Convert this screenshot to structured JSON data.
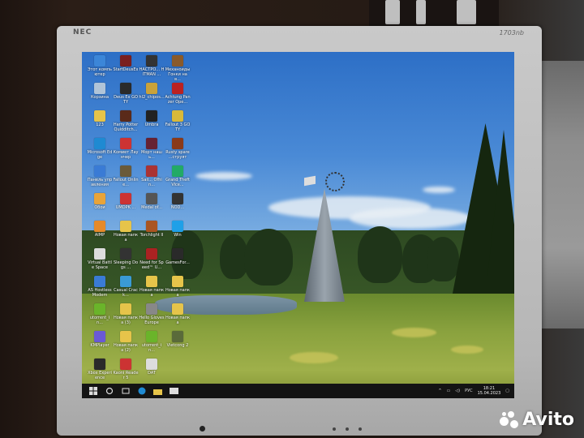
{
  "bezel": {
    "brand": "NEC",
    "model": "1703nb"
  },
  "taskbar": {
    "language": "РУС",
    "time": "18:21",
    "date": "15.04.2023"
  },
  "desktop_icons": [
    {
      "label": "Этот компьютер",
      "color": "#3c86d8"
    },
    {
      "label": "StartDeusEx",
      "color": "#7a1f1f"
    },
    {
      "label": "НАСТРО... HITMAN ...",
      "color": "#333"
    },
    {
      "label": "Механоиды Гонки на в...",
      "color": "#8a5a2a"
    },
    {
      "label": "Корзина",
      "color": "#b0c4d8"
    },
    {
      "label": "Deus Ex GOTY",
      "color": "#2a2a2a"
    },
    {
      "label": "hl2_chipos...",
      "color": "#c9a23a"
    },
    {
      "label": "Achtung Panzer Ope...",
      "color": "#b22"
    },
    {
      "label": "123",
      "color": "#e6c44a"
    },
    {
      "label": "Harry Potter Quidditch...",
      "color": "#5a2a1a"
    },
    {
      "label": "Umbra",
      "color": "#222"
    },
    {
      "label": "Fallout 3 GOTY",
      "color": "#d9b93a"
    },
    {
      "label": "Microsoft Edge",
      "color": "#1f8ad2"
    },
    {
      "label": "Комиет Лаунчер",
      "color": "#c33"
    },
    {
      "label": "Морт нашь...",
      "color": "#623"
    },
    {
      "label": "Rusty spare ...струят",
      "color": "#8a3a1a"
    },
    {
      "label": "Панель управления",
      "color": "#3a7bd5"
    },
    {
      "label": "Fallout Online...",
      "color": "#6a5a3a"
    },
    {
      "label": "Sail... Ofhin...",
      "color": "#a33"
    },
    {
      "label": "Grand Theft Vice...",
      "color": "#2a6"
    },
    {
      "label": "Обои",
      "color": "#e8a43a"
    },
    {
      "label": "UMDPK ...",
      "color": "#c33"
    },
    {
      "label": "Medal of...",
      "color": "#555"
    },
    {
      "label": "NOD...",
      "color": "#333"
    },
    {
      "label": "AIMP",
      "color": "#e68a2a"
    },
    {
      "label": "Новая папка",
      "color": "#e6c44a"
    },
    {
      "label": "Torchlight II",
      "color": "#a52"
    },
    {
      "label": "Win",
      "color": "#1fa0e8"
    },
    {
      "label": "Virtual Battle Space",
      "color": "#ddd"
    },
    {
      "label": "Sleeping Dogs ...",
      "color": "#333"
    },
    {
      "label": "Need for Speed™ U...",
      "color": "#a22"
    },
    {
      "label": "GamesFor...",
      "color": "#2a2a2a"
    },
    {
      "label": "AS Hostless Modem",
      "color": "#3a7bd5"
    },
    {
      "label": "Casual Crack...",
      "color": "#3a9ad5"
    },
    {
      "label": "Новая папка",
      "color": "#e6c44a"
    },
    {
      "label": "Новая папка",
      "color": "#e6c44a"
    },
    {
      "label": "utorrent_in...",
      "color": "#6ab42a"
    },
    {
      "label": "Новая папка (3)",
      "color": "#e6c44a"
    },
    {
      "label": "Hello Gloves Europe",
      "color": "#888"
    },
    {
      "label": "Новая папка",
      "color": "#e6c44a"
    },
    {
      "label": "KMPlayer",
      "color": "#6a5ad5"
    },
    {
      "label": "Новая папка (2)",
      "color": "#e6c44a"
    },
    {
      "label": "utorrent_in...",
      "color": "#6ab42a"
    },
    {
      "label": "Vietcong 2",
      "color": "#5a6a3a"
    },
    {
      "label": "Xbox Experience",
      "color": "#2a2a2a"
    },
    {
      "label": "Kaoni Reader 5",
      "color": "#c33"
    },
    {
      "label": "DAT",
      "color": "#ddd"
    }
  ],
  "watermark": "Avito"
}
